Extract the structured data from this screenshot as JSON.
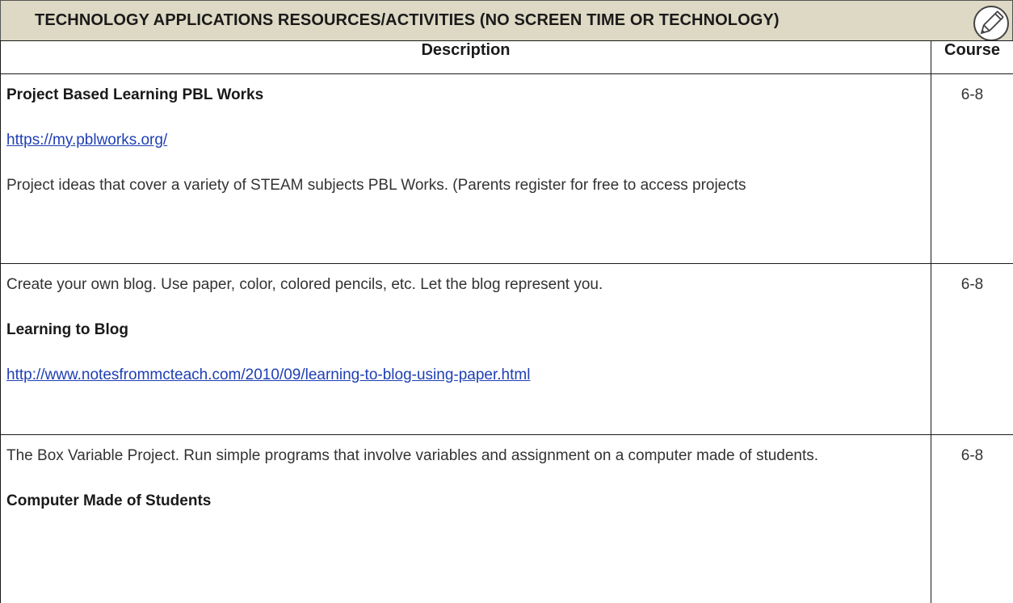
{
  "banner": {
    "title": "TECHNOLOGY APPLICATIONS RESOURCES/ACTIVITIES (NO SCREEN TIME OR TECHNOLOGY)",
    "icon": "pencil-icon"
  },
  "table": {
    "headers": {
      "description": "Description",
      "course": "Course"
    },
    "rows": [
      {
        "title": "Project Based Learning  PBL Works",
        "link": "https://my.pblworks.org/",
        "text": "Project ideas that cover a variety of STEAM subjects PBL Works. (Parents register for free to access projects",
        "course": "6-8"
      },
      {
        "text": "Create your own blog. Use paper, color, colored pencils, etc. Let the blog represent you.",
        "title": "Learning to Blog",
        "link": "http://www.notesfrommcteach.com/2010/09/learning-to-blog-using-paper.html",
        "course": "6-8"
      },
      {
        "text": "The Box Variable Project. Run simple programs that involve variables and assignment on a computer made of students.",
        "title": "Computer Made of Students",
        "course": "6-8"
      }
    ]
  }
}
